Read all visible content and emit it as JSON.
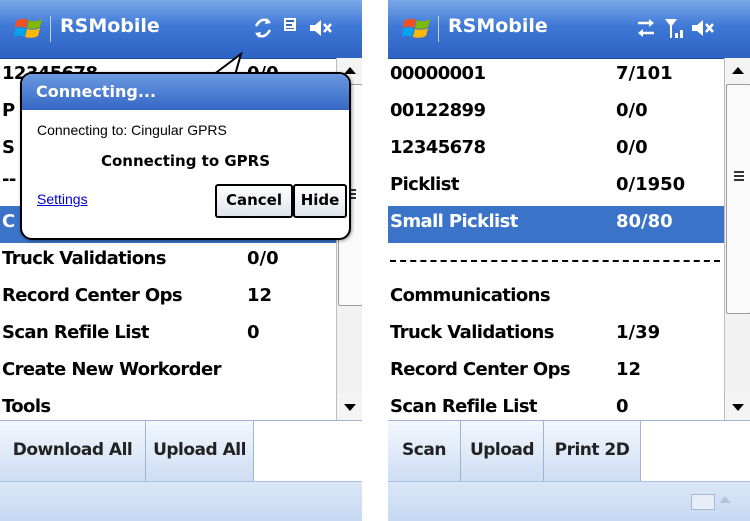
{
  "screen1": {
    "title": "RSMobile",
    "status_icons": [
      "connecting-arrows-icon",
      "e-signal-icon",
      "volume-mute-icon"
    ],
    "rows": [
      {
        "name": "12345678",
        "value": "0/0"
      },
      {
        "name": "P",
        "value": ""
      },
      {
        "name": "S",
        "value": ""
      },
      {
        "name": "--",
        "value": ""
      },
      {
        "name": "C",
        "value": ""
      },
      {
        "name": "Truck Validations",
        "value": "0/0"
      },
      {
        "name": "Record Center Ops",
        "value": "12"
      },
      {
        "name": "Scan Refile List",
        "value": "0"
      },
      {
        "name": "Create New Workorder",
        "value": ""
      },
      {
        "name": "Tools",
        "value": ""
      }
    ],
    "softkeys": [
      "Download All",
      "Upload All"
    ],
    "popup": {
      "title": "Connecting...",
      "message": "Connecting to: Cingular GPRS",
      "status": "Connecting to GPRS",
      "settings_link": "Settings",
      "cancel_label": "Cancel",
      "hide_label": "Hide"
    }
  },
  "screen2": {
    "title": "RSMobile",
    "status_icons": [
      "data-transfer-icon",
      "signal-strength-icon",
      "volume-mute-icon"
    ],
    "rows": [
      {
        "name": "00000001",
        "value": "7/101"
      },
      {
        "name": "00122899",
        "value": "0/0"
      },
      {
        "name": "12345678",
        "value": "0/0"
      },
      {
        "name": "Picklist",
        "value": "0/1950"
      },
      {
        "name": "Small Picklist",
        "value": "80/80",
        "selected": true
      },
      {
        "name": "Communications",
        "value": ""
      },
      {
        "name": "Truck Validations",
        "value": "1/39"
      },
      {
        "name": "Record Center Ops",
        "value": "12"
      },
      {
        "name": "Scan Refile List",
        "value": "0"
      }
    ],
    "softkeys": [
      "Scan",
      "Upload",
      "Print 2D"
    ]
  },
  "colors": {
    "titlebar": "#3f78d6",
    "selection": "#3a73c8",
    "popup_link": "#0000cc"
  }
}
